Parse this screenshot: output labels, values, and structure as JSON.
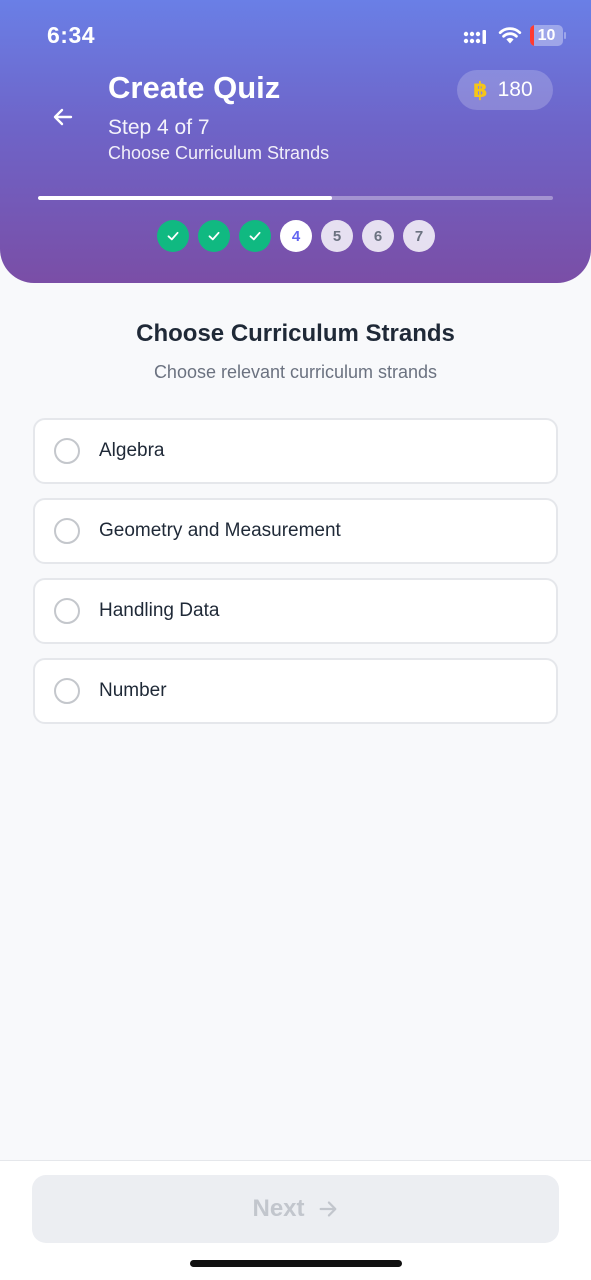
{
  "status_bar": {
    "time": "6:34",
    "battery_level": "10"
  },
  "header": {
    "title": "Create Quiz",
    "step_text": "Step 4 of 7",
    "step_subtitle": "Choose Curriculum Strands",
    "coin_symbol": "฿",
    "coins": "180",
    "progress_fraction": 0.57
  },
  "steps": [
    {
      "label": "1",
      "state": "done"
    },
    {
      "label": "2",
      "state": "done"
    },
    {
      "label": "3",
      "state": "done"
    },
    {
      "label": "4",
      "state": "current"
    },
    {
      "label": "5",
      "state": "future"
    },
    {
      "label": "6",
      "state": "future"
    },
    {
      "label": "7",
      "state": "future"
    }
  ],
  "main": {
    "title": "Choose Curriculum Strands",
    "subtitle": "Choose relevant curriculum strands",
    "options": [
      {
        "label": "Algebra"
      },
      {
        "label": "Geometry and Measurement"
      },
      {
        "label": "Handling Data"
      },
      {
        "label": "Number"
      }
    ]
  },
  "footer": {
    "next_label": "Next"
  },
  "colors": {
    "accent": "#6366f1",
    "done": "#10b981",
    "coin": "#f5c518"
  },
  "icons": {
    "back": "arrow-left-icon",
    "check": "check-icon",
    "next": "arrow-right-icon"
  }
}
